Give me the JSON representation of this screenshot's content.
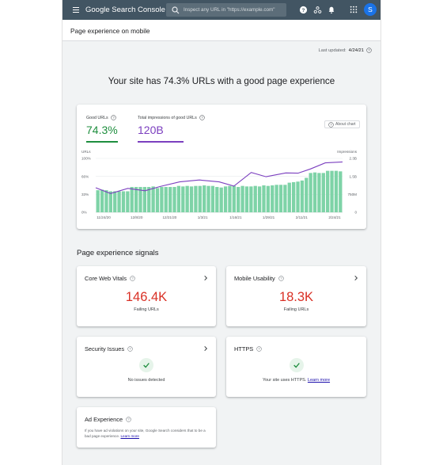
{
  "header": {
    "brand_google": "Google",
    "brand_product": "Search Console",
    "search_placeholder": "Inspect any URL in \"https://example.com\"",
    "avatar_letter": "S"
  },
  "page": {
    "title": "Page experience on mobile",
    "last_updated_label": "Last updated:",
    "last_updated_value": "4/24/21",
    "headline": "Your site has 74.3% URLs with a good page experience"
  },
  "metrics": {
    "good_urls_label": "Good URLs",
    "good_urls_value": "74.3%",
    "impressions_label": "Total impressions of good URLs",
    "impressions_value": "120B",
    "about_chart": "About chart"
  },
  "chart_data": {
    "type": "bar",
    "left_axis_title": "URLs",
    "right_axis_title": "Impressions",
    "left_ticks": [
      "100%",
      "66%",
      "33%",
      "0%"
    ],
    "right_ticks": [
      "2.3B",
      "1.5B",
      "750M",
      "0"
    ],
    "x_tick_labels": [
      "11/24/20",
      "12/8/20",
      "12/21/20",
      "1/3/21",
      "1/16/21",
      "1/29/21",
      "2/11/21",
      "2/24/21"
    ],
    "x_start": "11/24/20",
    "x_end": "2/24/21",
    "ylim_left": [
      0,
      100
    ],
    "ylim_right": [
      0,
      2.3
    ],
    "series": [
      {
        "name": "Good URLs",
        "type": "bar",
        "color": "#7ed3a7",
        "values": [
          41,
          42,
          41,
          39,
          39,
          39,
          39,
          39,
          47,
          47,
          47,
          47,
          47,
          48,
          45,
          47,
          47,
          47,
          47,
          49,
          48,
          49,
          48,
          49,
          49,
          50,
          49,
          49,
          47,
          46,
          48,
          49,
          49,
          47,
          49,
          48,
          48,
          49,
          48,
          50,
          49,
          50,
          51,
          51,
          51,
          55,
          56,
          57,
          59,
          64,
          73,
          74,
          73,
          73,
          77,
          77,
          77,
          76
        ]
      },
      {
        "name": "Total impressions of good URLs",
        "type": "line",
        "color": "#7b3fbf",
        "points": [
          [
            0,
            1.05
          ],
          [
            0.06,
            0.8
          ],
          [
            0.13,
            1.02
          ],
          [
            0.2,
            0.92
          ],
          [
            0.26,
            1.1
          ],
          [
            0.34,
            1.3
          ],
          [
            0.42,
            1.38
          ],
          [
            0.5,
            1.3
          ],
          [
            0.56,
            1.12
          ],
          [
            0.63,
            1.7
          ],
          [
            0.69,
            1.52
          ],
          [
            0.77,
            1.68
          ],
          [
            0.82,
            1.67
          ],
          [
            0.87,
            1.85
          ],
          [
            0.93,
            2.11
          ],
          [
            1.0,
            2.15
          ]
        ]
      }
    ],
    "grid": "horizontal"
  },
  "signals": {
    "section_title": "Page experience signals",
    "cwv": {
      "title": "Core Web Vitals",
      "value": "146.4K",
      "sub": "Failing URLs"
    },
    "mobile": {
      "title": "Mobile Usability",
      "value": "18.3K",
      "sub": "Failing URLs"
    },
    "security": {
      "title": "Security Issues",
      "status": "No issues detected"
    },
    "https": {
      "title": "HTTPS",
      "status": "Your site uses HTTPS.",
      "link": "Learn more"
    },
    "ad": {
      "title": "Ad Experience",
      "desc": "If you have ad violations on your site, Google Search considers that to be a bad page experience.",
      "link": "Learn more"
    }
  },
  "colors": {
    "topbar": "#425563",
    "good": "#1e8e3e",
    "impressions": "#7b3fbf",
    "failing": "#d93025"
  }
}
